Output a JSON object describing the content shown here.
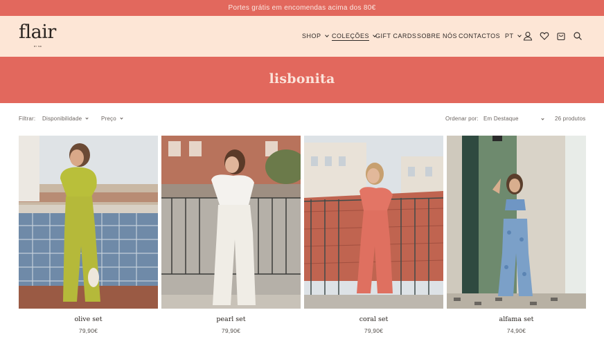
{
  "announcement": "Portes grátis em encomendas acima dos 80€",
  "logo": {
    "text": "flair",
    "tagline": "BY MD"
  },
  "nav": {
    "items": [
      {
        "label": "SHOP",
        "has_menu": true
      },
      {
        "label": "COLEÇÕES",
        "has_menu": true,
        "active": true
      },
      {
        "label": "GIFT CARDS",
        "has_menu": false
      },
      {
        "label": "SOBRE NÓS",
        "has_menu": false
      },
      {
        "label": "CONTACTOS",
        "has_menu": false
      }
    ],
    "language": "PT",
    "icons": [
      "user-icon",
      "heart-icon",
      "bag-icon",
      "search-icon"
    ]
  },
  "collection": {
    "title": "lisbonita"
  },
  "filters": {
    "label": "Filtrar:",
    "availability": "Disponibilidade",
    "price": "Preço",
    "sort_label": "Ordenar por:",
    "sort_value": "Em Destaque",
    "count": "26 produtos"
  },
  "products": [
    {
      "name": "olive set",
      "price": "79,90€"
    },
    {
      "name": "pearl set",
      "price": "79,90€"
    },
    {
      "name": "coral set",
      "price": "79,90€"
    },
    {
      "name": "alfama set",
      "price": "74,90€"
    }
  ],
  "colors": {
    "accent": "#e2685d",
    "header_bg": "#fde6d6",
    "banner_text": "#fbe3da"
  }
}
